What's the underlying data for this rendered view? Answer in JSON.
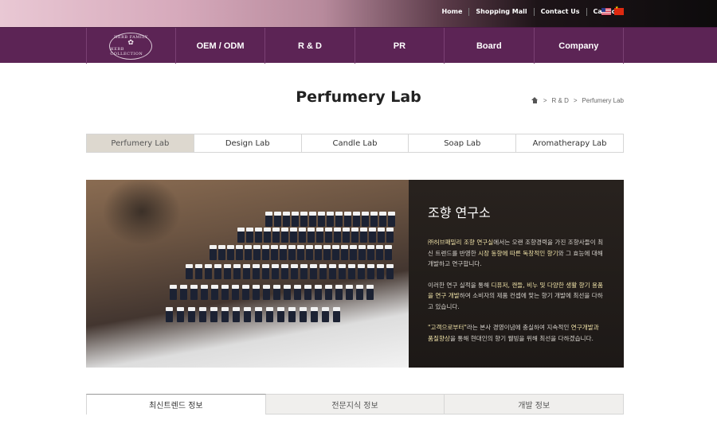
{
  "topbar": {
    "links": [
      "Home",
      "Shopping Mall",
      "Contact Us",
      "Catalog"
    ]
  },
  "nav": {
    "logo_lines": [
      "HERB FAMILY",
      "HERB COLLECTION"
    ],
    "items": [
      "OEM / ODM",
      "R & D",
      "PR",
      "Board",
      "Company"
    ]
  },
  "page": {
    "title": "Perfumery Lab",
    "breadcrumb": [
      "R & D",
      "Perfumery Lab"
    ]
  },
  "lab_tabs": {
    "items": [
      "Perfumery Lab",
      "Design Lab",
      "Candle Lab",
      "Soap Lab",
      "Aromatherapy Lab"
    ],
    "active": "Perfumery Lab"
  },
  "hero": {
    "heading": "조향 연구소",
    "p1_a": "㈜허브패밀리 조향 연구실",
    "p1_b": "에서는 오랜 조향경력을 가진 조향사들이 최신 트렌드를 반영한 ",
    "p1_c": "시장 동향에 따른 독창적인 향기",
    "p1_d": "와 그 효능에 대해 개발하고 연구합니다.",
    "p2_a": "이러한 연구 실적을 통해 ",
    "p2_b": "디퓨저, 캔들, 비누 및 다양한 생활 향기 용품을 연구 개발",
    "p2_c": "하여 소비자의 제품 컨셉에 맞는 향기 개발에 최선을 다하고 있습니다.",
    "p3_a": "\"고객으로부터\"",
    "p3_b": "라는 본사 경영이념에 충실하여 지속적인 ",
    "p3_c": "연구개발과 품질향상",
    "p3_d": "을 통해 현대인의 향기 웰빙을 위해 최선을 다하겠습니다."
  },
  "info_tabs": {
    "items": [
      "최신트렌드 정보",
      "전문지식 정보",
      "개발 정보"
    ],
    "active": "최신트렌드 정보"
  }
}
